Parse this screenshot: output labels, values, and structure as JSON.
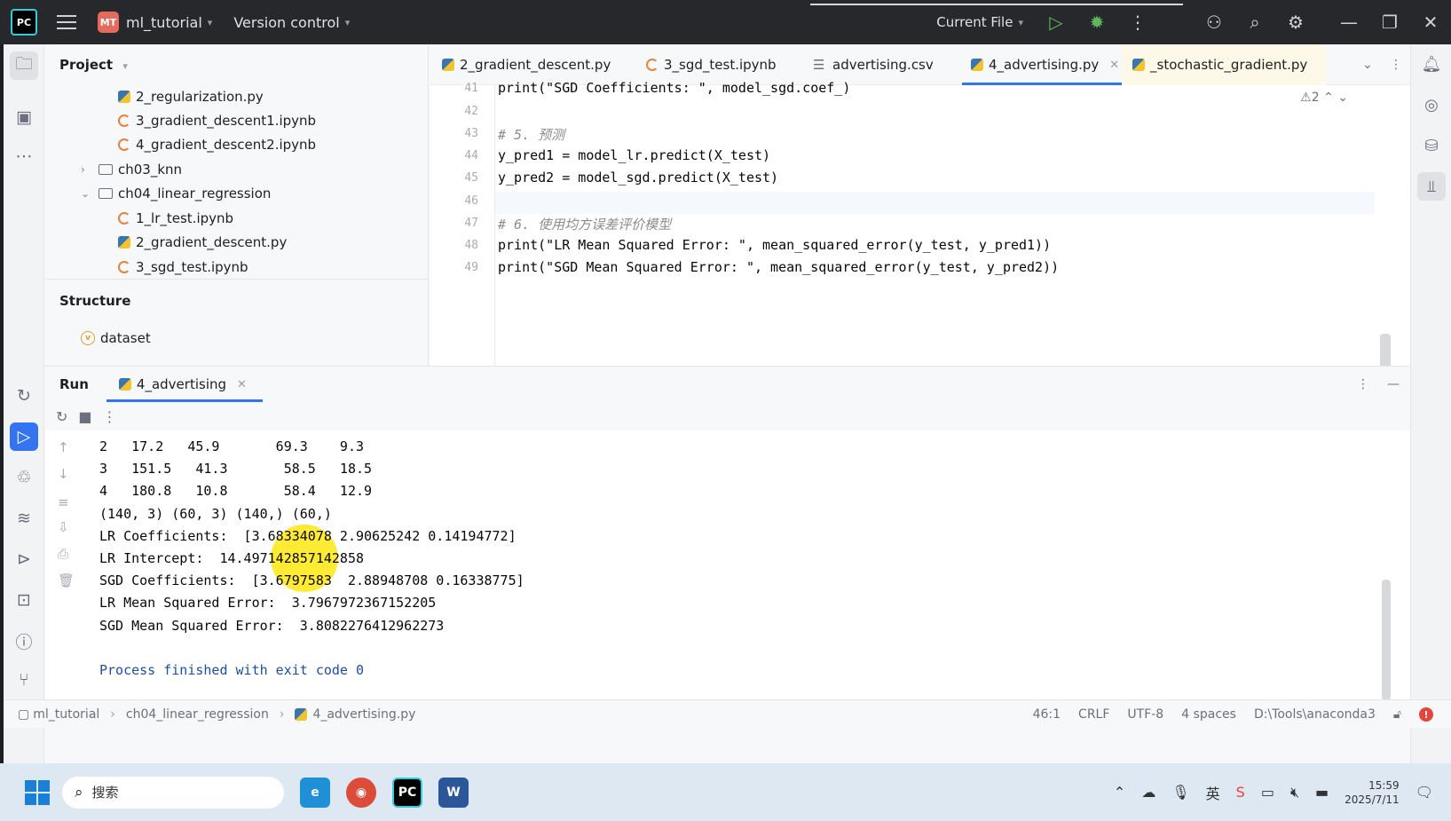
{
  "titlebar": {
    "logo": "PC",
    "project_badge": "MT",
    "project_name": "ml_tutorial",
    "vcs": "Version control",
    "run_config": "Current File"
  },
  "project_pane": {
    "title": "Project",
    "items": [
      {
        "label": "2_regularization.py",
        "type": "py"
      },
      {
        "label": "3_gradient_descent1.ipynb",
        "type": "nb"
      },
      {
        "label": "4_gradient_descent2.ipynb",
        "type": "nb"
      },
      {
        "label": "ch03_knn",
        "type": "folder",
        "state": "collapsed"
      },
      {
        "label": "ch04_linear_regression",
        "type": "folder",
        "state": "expanded"
      },
      {
        "label": "1_lr_test.ipynb",
        "type": "nb"
      },
      {
        "label": "2_gradient_descent.py",
        "type": "py"
      },
      {
        "label": "3_sgd_test.ipynb",
        "type": "nb"
      }
    ]
  },
  "structure_pane": {
    "title": "Structure",
    "items": [
      {
        "label": "dataset",
        "icon": "v"
      }
    ]
  },
  "tabs": [
    {
      "label": "2_gradient_descent.py",
      "type": "py"
    },
    {
      "label": "3_sgd_test.ipynb",
      "type": "nb"
    },
    {
      "label": "advertising.csv",
      "type": "csv"
    },
    {
      "label": "4_advertising.py",
      "type": "py",
      "active": true
    },
    {
      "label": "_stochastic_gradient.py",
      "type": "py"
    }
  ],
  "editor": {
    "warnings": "2",
    "lines": [
      {
        "n": "41",
        "text": "print(\"SGD Coefficients: \", model_sgd.coef_)"
      },
      {
        "n": "42",
        "text": ""
      },
      {
        "n": "43",
        "text": "# 5. 预测"
      },
      {
        "n": "44",
        "text": "y_pred1 = model_lr.predict(X_test)"
      },
      {
        "n": "45",
        "text": "y_pred2 = model_sgd.predict(X_test)"
      },
      {
        "n": "46",
        "text": ""
      },
      {
        "n": "47",
        "text": "# 6. 使用均方误差评价模型"
      },
      {
        "n": "48",
        "text": "print(\"LR Mean Squared Error: \", mean_squared_error(y_test, y_pred1))"
      },
      {
        "n": "49",
        "text": "print(\"SGD Mean Squared Error: \", mean_squared_error(y_test, y_pred2))"
      }
    ]
  },
  "run_panel": {
    "title": "Run",
    "tab_label": "4_advertising",
    "console": [
      "2   17.2   45.9       69.3    9.3",
      "3   151.5   41.3       58.5   18.5",
      "4   180.8   10.8       58.4   12.9",
      "(140, 3) (60, 3) (140,) (60,)",
      "LR Coefficients:  [3.68334078 2.90625242 0.14194772]",
      "LR Intercept:  14.497142857142858",
      "SGD Coefficients:  [3.6797583  2.88948708 0.16338775]",
      "LR Mean Squared Error:  3.7967972367152205",
      "SGD Mean Squared Error:  3.8082276412962273",
      "",
      "Process finished with exit code 0"
    ]
  },
  "statusbar": {
    "crumbs": [
      "ml_tutorial",
      "ch04_linear_regression",
      "4_advertising.py"
    ],
    "position": "46:1",
    "line_sep": "CRLF",
    "encoding": "UTF-8",
    "indent": "4 spaces",
    "interpreter": "D:\\Tools\\anaconda3"
  },
  "taskbar": {
    "search_placeholder": "搜索",
    "time": "15:59",
    "date": "2025/7/11"
  },
  "colors": {
    "accent": "#3574f0",
    "run_green": "#5fb85f",
    "error_red": "#e5453b"
  }
}
